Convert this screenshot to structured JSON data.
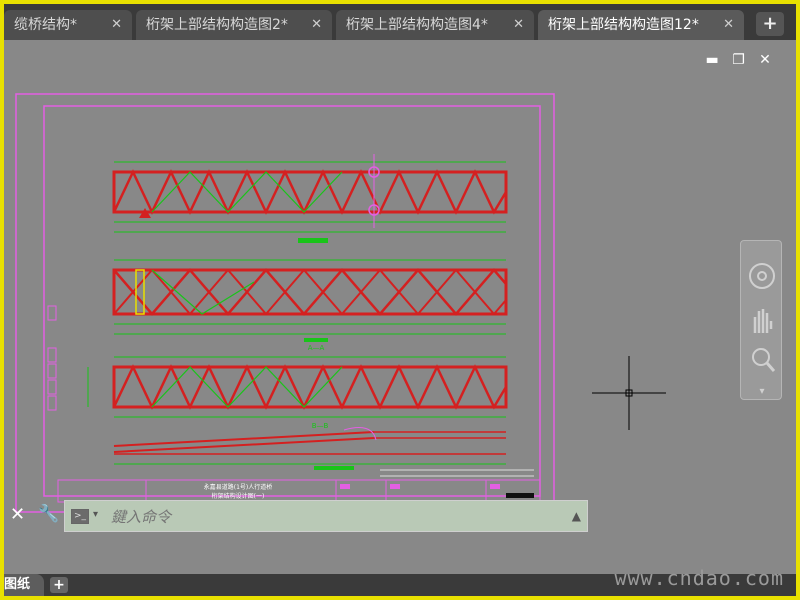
{
  "tabs": [
    {
      "label": "缆桥结构*",
      "active": false
    },
    {
      "label": "桁架上部结构构造图2*",
      "active": false
    },
    {
      "label": "桁架上部结构构造图4*",
      "active": false
    },
    {
      "label": "桁架上部结构构造图12*",
      "active": true
    }
  ],
  "tab_close_glyph": "✕",
  "new_tab_glyph": "+",
  "window_controls": {
    "minimize": "▬",
    "restore": "❐",
    "close": "✕"
  },
  "drawing": {
    "section_labels": [
      "A—A",
      "B—B"
    ],
    "title_block_line1": "永嘉县道路(1号)人行道桥",
    "title_block_line2": "桁架结构设计图(一)"
  },
  "command_line": {
    "close_glyph": "✕",
    "tools_glyph": "🔧",
    "prompt_icon": ">_",
    "dropdown_glyph": "▾",
    "placeholder": "鍵入命令",
    "expand_glyph": "▲"
  },
  "layout_tabs": {
    "current": "图纸",
    "add_glyph": "+"
  },
  "watermark": "www.cndao.com",
  "colors": {
    "truss": "#d42020",
    "dimension": "#19c419",
    "border": "#e35fe3",
    "background": "#888888"
  }
}
